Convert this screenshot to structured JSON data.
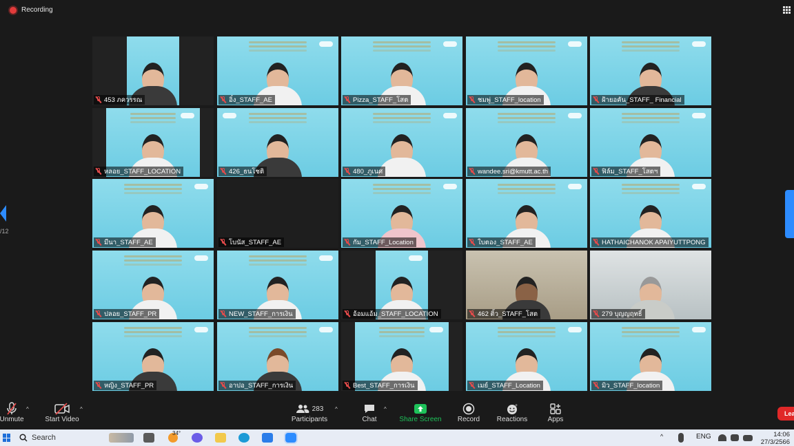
{
  "recording": {
    "label": "Recording"
  },
  "pagination": {
    "page": "/12"
  },
  "participants": [
    {
      "name": "453 ภควรรณ"
    },
    {
      "name": "อิ๋ง_STAFF_AE"
    },
    {
      "name": "Pizza_STAFF_โสต"
    },
    {
      "name": "ชมพู่_STAFF_location"
    },
    {
      "name": "ฝ้ายอคัน_STAFF_ Financial"
    },
    {
      "name": "หลอย_STAFF_LOCATION"
    },
    {
      "name": "426_ธนโชติ"
    },
    {
      "name": "480_ภูเนศ"
    },
    {
      "name": "wandee.sri@kmutt.ac.th"
    },
    {
      "name": "ฟิล์ม_STAFF_โสตฯ"
    },
    {
      "name": "มีนา_STAFF_AE"
    },
    {
      "name": "โบนัส_STAFF_AE"
    },
    {
      "name": "กัม_STAFF_Location"
    },
    {
      "name": "ใบตอง_STAFF_AE"
    },
    {
      "name": "HATHAICHANOK APAIYUTTPONG"
    },
    {
      "name": "ปลอย_STAFF_PR"
    },
    {
      "name": "NEW_STAFF_การเงิน"
    },
    {
      "name": "อ้อมแอ้ม_STAFF_LOCATION"
    },
    {
      "name": "462 ติ้ว_STAFF_โสต"
    },
    {
      "name": "279 บุญญฤทธิ์"
    },
    {
      "name": "หญิง_STAFF_PR"
    },
    {
      "name": "อาปอ_STAFF_การเงิน"
    },
    {
      "name": "Best_STAFF_การเงิน"
    },
    {
      "name": "เมย์_STAFF_Location"
    },
    {
      "name": "มิว_STAFF_location"
    }
  ],
  "toolbar": {
    "unmute": "Unmute",
    "start_video": "Start Video",
    "participants_label": "Participants",
    "participants_count": "283",
    "chat": "Chat",
    "share_screen": "Share Screen",
    "record": "Record",
    "reactions": "Reactions",
    "apps": "Apps",
    "leave": "Leave"
  },
  "taskbar": {
    "search": "Search",
    "weather": "34°",
    "language": "ENG",
    "time": "14:06",
    "date": "27/3/2566"
  },
  "colors": {
    "accent": "#2d8cff",
    "share": "#1ec25a",
    "mute": "#e54b4b",
    "leave": "#e02828"
  }
}
